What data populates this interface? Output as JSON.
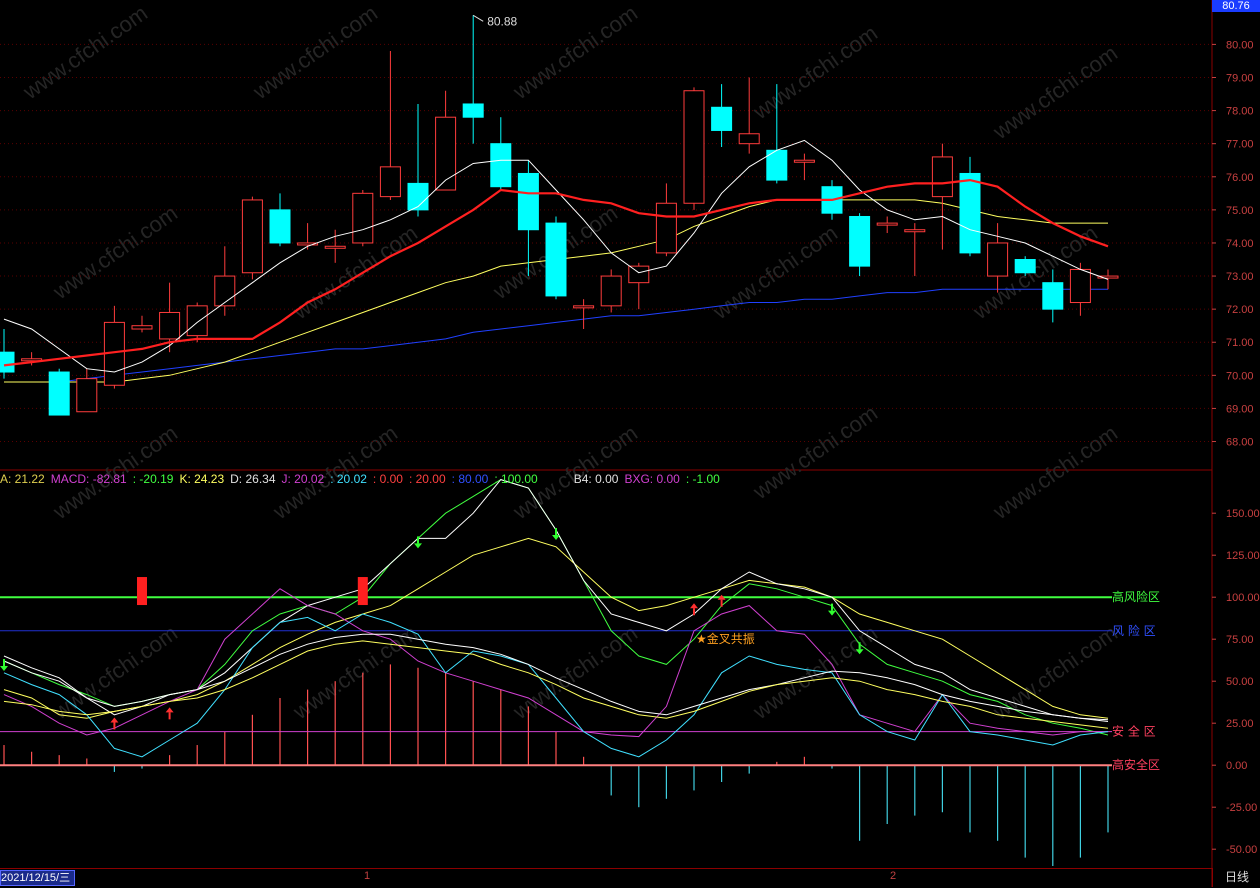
{
  "header": {
    "last_price": "80.76"
  },
  "price_axis": {
    "ticks": [
      "80.00",
      "79.00",
      "78.00",
      "77.00",
      "76.00",
      "75.00",
      "74.00",
      "73.00",
      "72.00",
      "71.00",
      "70.00",
      "69.00",
      "68.00"
    ]
  },
  "high_marker": "80.88",
  "indicator_bar": [
    {
      "text": "A: 21.22",
      "color": "#e0d050"
    },
    {
      "text": "MACD: -82.81",
      "color": "#d040d0"
    },
    {
      "text": ": -20.19",
      "color": "#40ff40"
    },
    {
      "text": "K: 24.23",
      "color": "#ffff60"
    },
    {
      "text": "D: 26.34",
      "color": "#e0e0e0"
    },
    {
      "text": "J: 20.02",
      "color": "#d040d0"
    },
    {
      "text": ": 20.02",
      "color": "#40e0ff"
    },
    {
      "text": ": 0.00",
      "color": "#ff4040"
    },
    {
      "text": ": 20.00",
      "color": "#ff4040"
    },
    {
      "text": ": 80.00",
      "color": "#3050ff"
    },
    {
      "text": ": 100.00",
      "color": "#40ff40"
    },
    {
      "text": "B4: 0.00",
      "color": "#e0e0e0"
    },
    {
      "text": "BXG: 0.00",
      "color": "#d040d0"
    },
    {
      "text": ": -1.00",
      "color": "#40ff40"
    }
  ],
  "osc_axis": {
    "ticks": [
      "150.00",
      "125.00",
      "100.00",
      "75.00",
      "50.00",
      "25.00",
      "0.00",
      "-25.00",
      "-50.00"
    ]
  },
  "zones": {
    "high_risk": "高风险区",
    "risk": "风 险 区",
    "safe": "安 全 区",
    "high_safe": "高安全区"
  },
  "signal_label": "★金叉共振",
  "watermark": "www.cfchi.com",
  "footer": {
    "date": "2021/12/15/三",
    "marker_1": "1",
    "marker_2": "2",
    "period": "日线"
  },
  "colors": {
    "up": "#ff3c3c",
    "down": "#00ffff",
    "ma5": "#ffffff",
    "ma10": "#ff2020",
    "ma20": "#ffff60",
    "ma60": "#2040ff"
  },
  "chart_data": {
    "type": "candlestick",
    "candles": [
      {
        "o": 70.7,
        "c": 70.1,
        "h": 71.4,
        "l": 69.9
      },
      {
        "o": 70.5,
        "c": 70.5,
        "h": 70.7,
        "l": 70.3
      },
      {
        "o": 70.1,
        "c": 68.8,
        "h": 70.2,
        "l": 68.8
      },
      {
        "o": 68.9,
        "c": 69.9,
        "h": 70.2,
        "l": 68.9
      },
      {
        "o": 69.7,
        "c": 71.6,
        "h": 72.1,
        "l": 69.6
      },
      {
        "o": 71.4,
        "c": 71.5,
        "h": 71.8,
        "l": 71.3
      },
      {
        "o": 71.1,
        "c": 71.9,
        "h": 72.8,
        "l": 70.7
      },
      {
        "o": 71.2,
        "c": 72.1,
        "h": 72.2,
        "l": 71.0
      },
      {
        "o": 72.1,
        "c": 73.0,
        "h": 73.9,
        "l": 71.8
      },
      {
        "o": 73.1,
        "c": 75.3,
        "h": 75.4,
        "l": 72.9
      },
      {
        "o": 75.0,
        "c": 74.0,
        "h": 75.5,
        "l": 73.9
      },
      {
        "o": 74.0,
        "c": 74.0,
        "h": 74.6,
        "l": 73.8
      },
      {
        "o": 73.9,
        "c": 73.9,
        "h": 74.4,
        "l": 73.4
      },
      {
        "o": 74.0,
        "c": 75.5,
        "h": 75.6,
        "l": 73.9
      },
      {
        "o": 75.4,
        "c": 76.3,
        "h": 79.8,
        "l": 75.3
      },
      {
        "o": 75.8,
        "c": 75.0,
        "h": 78.2,
        "l": 74.8
      },
      {
        "o": 75.6,
        "c": 77.8,
        "h": 78.6,
        "l": 75.6
      },
      {
        "o": 78.2,
        "c": 77.8,
        "h": 80.88,
        "l": 77.0
      },
      {
        "o": 77.0,
        "c": 75.7,
        "h": 77.8,
        "l": 75.6
      },
      {
        "o": 76.1,
        "c": 74.4,
        "h": 76.5,
        "l": 73.0
      },
      {
        "o": 74.6,
        "c": 72.4,
        "h": 74.8,
        "l": 72.3
      },
      {
        "o": 72.1,
        "c": 72.1,
        "h": 72.3,
        "l": 71.4
      },
      {
        "o": 72.1,
        "c": 73.0,
        "h": 73.2,
        "l": 71.9
      },
      {
        "o": 72.8,
        "c": 73.3,
        "h": 73.4,
        "l": 72.0
      },
      {
        "o": 73.7,
        "c": 75.2,
        "h": 75.8,
        "l": 73.6
      },
      {
        "o": 75.2,
        "c": 78.6,
        "h": 78.7,
        "l": 75.0
      },
      {
        "o": 78.1,
        "c": 77.4,
        "h": 78.8,
        "l": 76.9
      },
      {
        "o": 77.0,
        "c": 77.3,
        "h": 79.0,
        "l": 76.7
      },
      {
        "o": 76.8,
        "c": 75.9,
        "h": 78.8,
        "l": 75.8
      },
      {
        "o": 76.5,
        "c": 76.5,
        "h": 76.7,
        "l": 75.9
      },
      {
        "o": 75.7,
        "c": 74.9,
        "h": 75.9,
        "l": 74.7
      },
      {
        "o": 74.8,
        "c": 73.3,
        "h": 74.9,
        "l": 73.0
      },
      {
        "o": 74.6,
        "c": 74.6,
        "h": 74.8,
        "l": 74.3
      },
      {
        "o": 74.4,
        "c": 74.4,
        "h": 74.6,
        "l": 73.0
      },
      {
        "o": 75.4,
        "c": 76.6,
        "h": 77.0,
        "l": 73.8
      },
      {
        "o": 76.1,
        "c": 73.7,
        "h": 76.6,
        "l": 73.6
      },
      {
        "o": 73.0,
        "c": 74.0,
        "h": 74.6,
        "l": 72.5
      },
      {
        "o": 73.5,
        "c": 73.1,
        "h": 73.6,
        "l": 73.0
      },
      {
        "o": 72.8,
        "c": 72.0,
        "h": 73.2,
        "l": 71.6
      },
      {
        "o": 72.2,
        "c": 73.2,
        "h": 73.4,
        "l": 71.8
      },
      {
        "o": 73.0,
        "c": 73.0,
        "h": 73.2,
        "l": 72.6
      }
    ],
    "ma": {
      "ma5": [
        71.7,
        71.4,
        70.8,
        70.2,
        70.1,
        70.4,
        70.9,
        71.6,
        72.2,
        72.8,
        73.4,
        73.9,
        74.2,
        74.4,
        74.7,
        75.1,
        75.9,
        76.4,
        76.5,
        76.5,
        75.6,
        74.7,
        73.7,
        73.1,
        73.3,
        74.3,
        75.5,
        76.3,
        76.8,
        77.1,
        76.5,
        75.6,
        75.0,
        74.7,
        74.8,
        74.4,
        74.2,
        74.0,
        73.6,
        73.2,
        72.9
      ],
      "ma10": [
        70.3,
        70.4,
        70.5,
        70.6,
        70.7,
        70.8,
        71.0,
        71.1,
        71.1,
        71.1,
        71.6,
        72.2,
        72.6,
        73.1,
        73.6,
        74.0,
        74.5,
        75.0,
        75.6,
        75.5,
        75.5,
        75.3,
        75.2,
        74.9,
        74.8,
        74.8,
        75.0,
        75.2,
        75.3,
        75.3,
        75.3,
        75.5,
        75.7,
        75.8,
        75.8,
        75.9,
        75.7,
        75.1,
        74.6,
        74.2,
        73.9
      ],
      "ma20": [
        69.8,
        69.8,
        69.8,
        69.8,
        69.8,
        69.9,
        70.0,
        70.2,
        70.4,
        70.7,
        71.0,
        71.3,
        71.6,
        71.9,
        72.2,
        72.5,
        72.8,
        73.0,
        73.3,
        73.4,
        73.5,
        73.6,
        73.7,
        73.9,
        74.1,
        74.5,
        74.8,
        75.1,
        75.3,
        75.3,
        75.3,
        75.3,
        75.3,
        75.3,
        75.2,
        75.0,
        74.8,
        74.7,
        74.6,
        74.6,
        74.6
      ],
      "ma60": [
        69.8,
        69.8,
        69.8,
        69.9,
        70.0,
        70.1,
        70.2,
        70.3,
        70.4,
        70.5,
        70.6,
        70.7,
        70.8,
        70.8,
        70.9,
        71.0,
        71.1,
        71.3,
        71.4,
        71.5,
        71.6,
        71.7,
        71.8,
        71.8,
        71.9,
        72.0,
        72.1,
        72.2,
        72.2,
        72.3,
        72.3,
        72.4,
        72.5,
        72.5,
        72.6,
        72.6,
        72.6,
        72.6,
        72.6,
        72.6,
        72.6
      ]
    },
    "oscillator": {
      "white": [
        65,
        58,
        52,
        40,
        30,
        35,
        42,
        45,
        55,
        70,
        85,
        95,
        100,
        105,
        120,
        135,
        135,
        150,
        170,
        165,
        140,
        110,
        90,
        85,
        80,
        90,
        105,
        115,
        108,
        105,
        100,
        80,
        70,
        60,
        55,
        45,
        40,
        35,
        30,
        28,
        26
      ],
      "yellow": [
        45,
        40,
        30,
        28,
        32,
        35,
        38,
        42,
        50,
        60,
        70,
        78,
        85,
        90,
        95,
        105,
        115,
        125,
        130,
        135,
        130,
        115,
        100,
        92,
        95,
        100,
        105,
        110,
        108,
        106,
        100,
        90,
        85,
        80,
        75,
        65,
        55,
        45,
        35,
        30,
        28
      ],
      "green": [
        62,
        55,
        48,
        42,
        35,
        38,
        42,
        45,
        60,
        80,
        90,
        95,
        90,
        100,
        120,
        135,
        150,
        160,
        170,
        165,
        140,
        110,
        80,
        65,
        60,
        75,
        95,
        108,
        105,
        100,
        95,
        72,
        60,
        55,
        50,
        42,
        38,
        30,
        25,
        22,
        18
      ],
      "magenta": [
        42,
        35,
        25,
        18,
        22,
        30,
        38,
        45,
        75,
        90,
        105,
        95,
        90,
        80,
        75,
        62,
        55,
        50,
        45,
        40,
        30,
        20,
        18,
        17,
        35,
        80,
        90,
        95,
        80,
        78,
        60,
        30,
        25,
        20,
        42,
        25,
        22,
        20,
        18,
        20,
        20
      ],
      "cyan": [
        55,
        48,
        42,
        30,
        10,
        5,
        15,
        25,
        45,
        70,
        85,
        88,
        80,
        90,
        85,
        78,
        55,
        68,
        65,
        60,
        40,
        20,
        10,
        5,
        15,
        30,
        55,
        65,
        60,
        57,
        55,
        30,
        20,
        15,
        42,
        20,
        18,
        15,
        12,
        18,
        20
      ],
      "white2": [
        62,
        55,
        50,
        40,
        35,
        38,
        42,
        45,
        50,
        58,
        66,
        72,
        76,
        78,
        78,
        75,
        72,
        70,
        66,
        60,
        52,
        45,
        38,
        32,
        30,
        35,
        40,
        45,
        48,
        52,
        56,
        55,
        52,
        48,
        42,
        38,
        35,
        32,
        30,
        28,
        27
      ],
      "yellow2": [
        38,
        36,
        32,
        30,
        32,
        35,
        38,
        40,
        45,
        52,
        60,
        68,
        72,
        74,
        72,
        70,
        68,
        66,
        60,
        55,
        48,
        40,
        35,
        30,
        28,
        32,
        38,
        44,
        48,
        50,
        52,
        50,
        45,
        42,
        38,
        35,
        30,
        28,
        26,
        24,
        22
      ],
      "bars": [
        12,
        8,
        6,
        4,
        -4,
        -2,
        6,
        12,
        20,
        30,
        40,
        45,
        50,
        55,
        60,
        58,
        55,
        50,
        45,
        35,
        20,
        5,
        -18,
        -25,
        -20,
        -15,
        -10,
        -5,
        2,
        5,
        -2,
        -45,
        -35,
        -30,
        -28,
        -40,
        -45,
        -55,
        -60,
        -55,
        -40
      ],
      "signals_red": [
        5,
        13
      ],
      "arrows_up": [
        4,
        6,
        25,
        26
      ],
      "arrows_down": [
        0,
        15,
        20,
        30,
        31
      ]
    },
    "osc_ylim": [
      -60,
      165
    ],
    "price_ylim": [
      67.2,
      81.1
    ],
    "levels": {
      "high_risk": 100,
      "risk": 80,
      "safe": 20,
      "high_safe": 0
    }
  }
}
